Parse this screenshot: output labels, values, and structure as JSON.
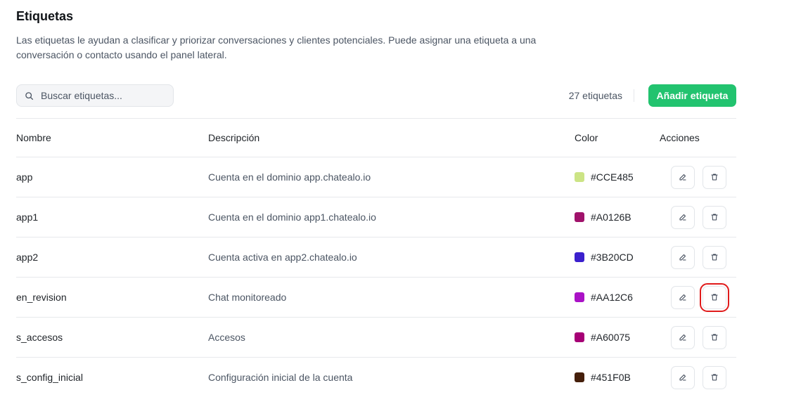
{
  "page": {
    "title": "Etiquetas",
    "description": "Las etiquetas le ayudan a clasificar y priorizar conversaciones y clientes potenciales. Puede asignar una etiqueta a una conversación o contacto usando el panel lateral."
  },
  "toolbar": {
    "search_placeholder": "Buscar etiquetas...",
    "count_text": "27 etiquetas",
    "add_label": "Añadir etiqueta"
  },
  "table": {
    "headers": [
      "Nombre",
      "Descripción",
      "Color",
      "Acciones"
    ],
    "rows": [
      {
        "name": "app",
        "description": "Cuenta en el dominio app.chatealo.io",
        "color": "#CCE485"
      },
      {
        "name": "app1",
        "description": "Cuenta en el dominio app1.chatealo.io",
        "color": "#A0126B"
      },
      {
        "name": "app2",
        "description": "Cuenta activa en app2.chatealo.io",
        "color": "#3B20CD"
      },
      {
        "name": "en_revision",
        "description": "Chat monitoreado",
        "color": "#AA12C6"
      },
      {
        "name": "s_accesos",
        "description": "Accesos",
        "color": "#A60075"
      },
      {
        "name": "s_config_inicial",
        "description": "Configuración inicial de la cuenta",
        "color": "#451F0B"
      }
    ]
  },
  "colors": {
    "accent": "#22c36f",
    "highlight": "#e01b1b"
  },
  "icons": {
    "search": "search-icon",
    "edit": "pencil-icon",
    "delete": "trash-icon"
  }
}
